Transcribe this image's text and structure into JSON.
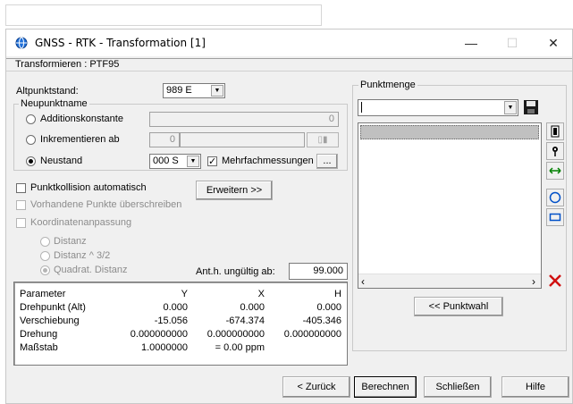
{
  "window": {
    "title": "GNSS - RTK - Transformation [1]",
    "subtitle": "Transformieren : PTF95",
    "minimize_symbol": "—",
    "maximize_symbol": "☐",
    "close_symbol": "✕"
  },
  "left": {
    "altpunktstand_label": "Altpunktstand:",
    "altpunktstand_value": "989  E",
    "neupunktname_title": "Neupunktname",
    "additionskonstante_label": "Additionskonstante",
    "additionskonstante_value": "0",
    "inkrementieren_label": "Inkrementieren ab",
    "inkrementieren_value": "0",
    "neustand_label": "Neustand",
    "neustand_value": "000  S",
    "mehrfach_label": "Mehrfachmessungen",
    "ellipsis_label": "...",
    "punktkollision_label": "Punktkollision automatisch",
    "erweitern_label": "Erweitern >>",
    "vorhandene_label": "Vorhandene Punkte überschreiben",
    "koordinaten_label": "Koordinatenanpassung",
    "distanz_label": "Distanz",
    "distanz32_label": "Distanz ^ 3/2",
    "quadrat_label": "Quadrat. Distanz",
    "anth_label": "Ant.h. ungültig ab:",
    "anth_value": "99.000"
  },
  "table": {
    "headers": [
      "Parameter",
      "Y",
      "X",
      "H"
    ],
    "rows": [
      [
        "Drehpunkt (Alt)",
        "0.000",
        "0.000",
        "0.000"
      ],
      [
        "Verschiebung",
        "-15.056",
        "-674.374",
        "-405.346"
      ],
      [
        "Drehung",
        "0.000000000",
        "0.000000000",
        "0.000000000"
      ],
      [
        "Maßstab",
        "1.0000000",
        "= 0.00 ppm",
        ""
      ]
    ]
  },
  "right": {
    "punktmenge_title": "Punktmenge",
    "punktmenge_value": "",
    "punktwahl_label": "<< Punktwahl"
  },
  "footer": {
    "zurueck_label": "< Zurück",
    "berechnen_label": "Berechnen",
    "schliessen_label": "Schließen",
    "hilfe_label": "Hilfe"
  },
  "colors": {
    "window_bg": "#f0f0f0",
    "accent_blue": "#0050c8",
    "delete_red": "#d01010",
    "listbox_selected": "#c0c0c0"
  },
  "icons": [
    "globe-icon",
    "save-icon",
    "clipboard-icon",
    "pin-icon",
    "arrows-horizontal-icon",
    "circle-icon",
    "rectangle-icon",
    "delete-icon"
  ]
}
